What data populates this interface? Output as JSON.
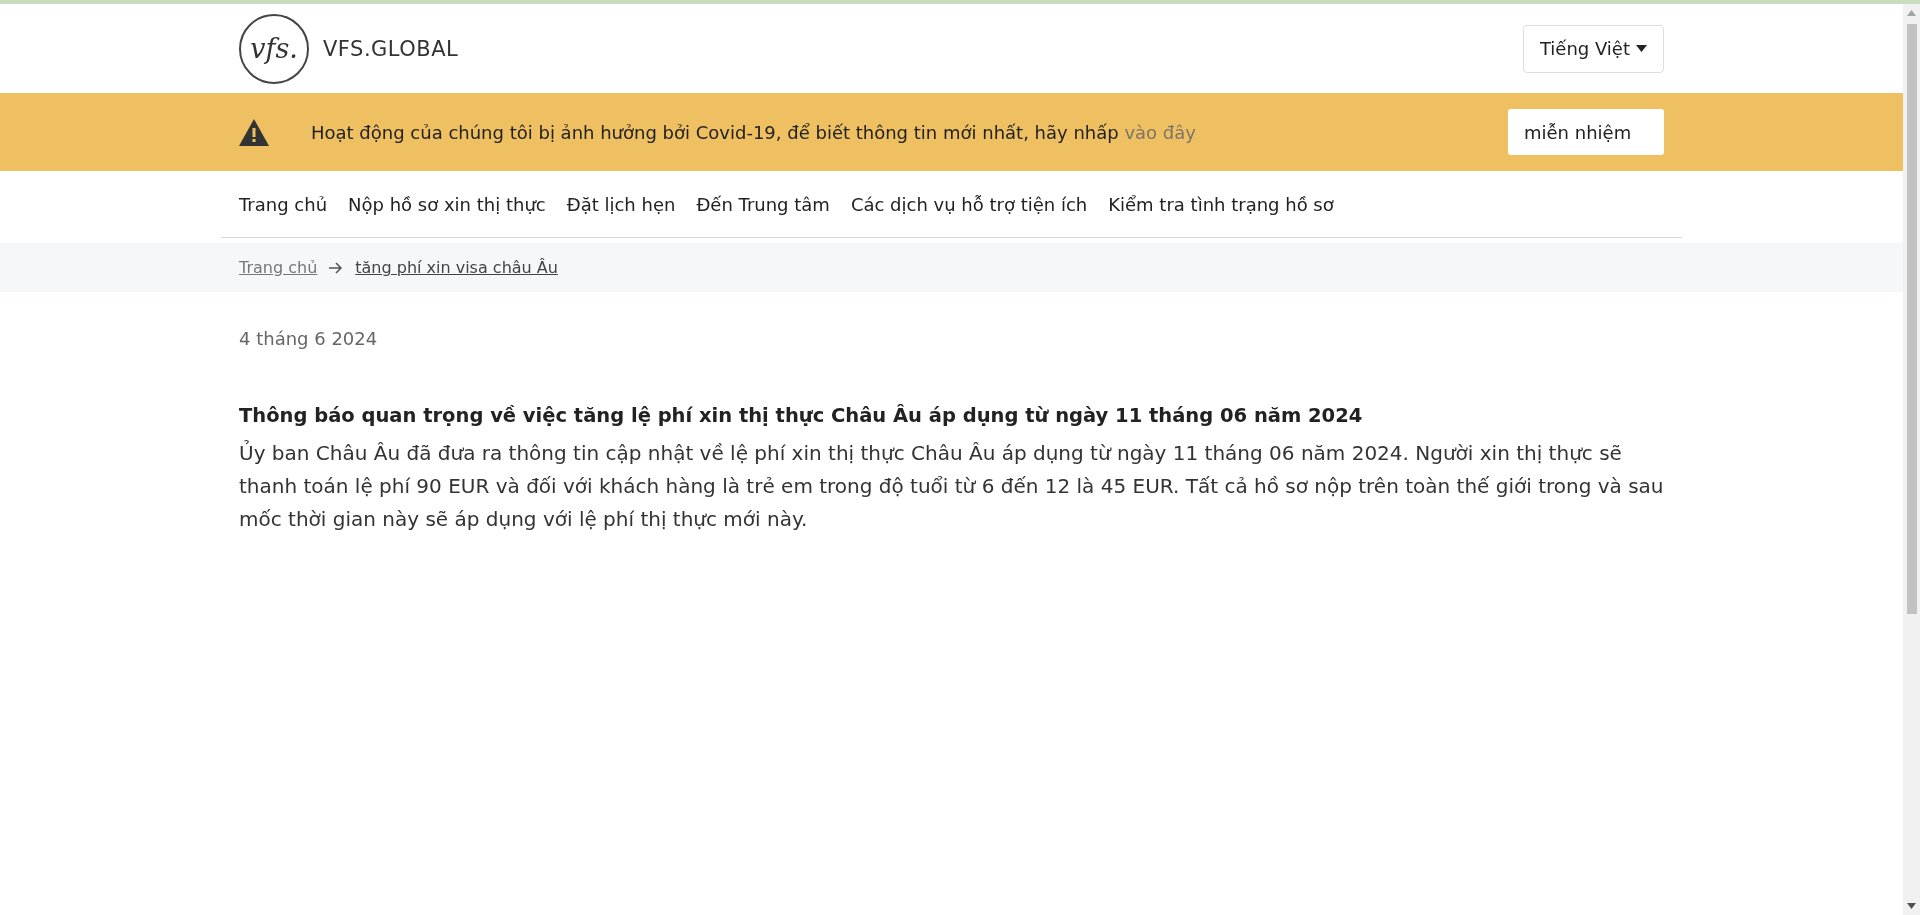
{
  "header": {
    "logo_mark": "vfs.",
    "logo_text": "VFS.GLOBAL",
    "language": "Tiếng Việt"
  },
  "alert": {
    "message": "Hoạt động của chúng tôi bị ảnh hưởng bởi Covid-19, để biết thông tin mới nhất, hãy nhấp",
    "link": "vào đây",
    "button": "miễn nhiệm"
  },
  "nav": [
    {
      "label": "Trang chủ"
    },
    {
      "label": "Nộp hồ sơ xin thị thực"
    },
    {
      "label": "Đặt lịch hẹn"
    },
    {
      "label": "Đến Trung tâm"
    },
    {
      "label": "Các dịch vụ hỗ trợ tiện ích"
    },
    {
      "label": "Kiểm tra tình trạng hồ sơ"
    }
  ],
  "breadcrumb": [
    "Trang chủ",
    "tăng phí xin visa châu Âu"
  ],
  "article": {
    "date": "4 tháng 6 2024",
    "title": "Thông báo quan trọng về việc tăng lệ phí xin thị thực Châu Âu áp dụng từ ngày 11 tháng 06 năm 2024",
    "body": "Ủy ban Châu Âu đã đưa ra thông tin cập nhật về lệ phí xin thị thực Châu Âu áp dụng từ ngày 11 tháng 06 năm 2024. Người xin thị thực sẽ thanh toán lệ phí 90 EUR và đối với khách hàng là trẻ em trong độ tuổi từ 6 đến 12 là 45 EUR. Tất cả hồ sơ nộp trên toàn thế giới trong và sau mốc thời gian này sẽ áp dụng với lệ phí thị thực mới này."
  }
}
